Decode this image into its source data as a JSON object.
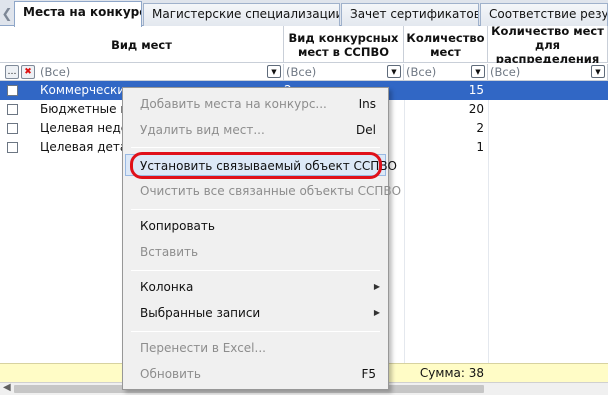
{
  "tabs": [
    {
      "label": "Места на конкурс",
      "active": true
    },
    {
      "label": "Магистерские специализации",
      "active": false
    },
    {
      "label": "Зачет сертификатов",
      "active": false
    },
    {
      "label": "Соответствие резуль",
      "active": false
    }
  ],
  "columns": {
    "vid_mest": "Вид мест",
    "konkurs_ssp": "Вид конкурсных мест в ССПВО",
    "kolichestvo": "Количество мест",
    "raspredelenie": "Количество мест для распределения"
  },
  "filter": {
    "value": "(Все)"
  },
  "rows": [
    {
      "name": "Коммерческие",
      "c3": "2",
      "count": "15",
      "selected": true
    },
    {
      "name": "Бюджетные ме",
      "c3": "",
      "count": "20",
      "selected": false
    },
    {
      "name": "Целевая недета",
      "c3": "",
      "count": "2",
      "selected": false
    },
    {
      "name": "Целевая детали",
      "c3": "",
      "count": "1",
      "selected": false
    }
  ],
  "footer": {
    "sum": "Сумма: 38"
  },
  "context_menu": {
    "items": [
      {
        "label": "Добавить места на конкурс...",
        "shortcut": "Ins",
        "disabled": true
      },
      {
        "label": "Удалить вид мест...",
        "shortcut": "Del",
        "disabled": true
      },
      {
        "label": "Установить связываемый объект ССПВО",
        "highlighted": true
      },
      {
        "label": "Очистить все связанные объекты ССПВО",
        "disabled": true
      },
      {
        "label": "Копировать",
        "disabled": false
      },
      {
        "label": "Вставить",
        "disabled": true
      },
      {
        "label": "Колонка",
        "submenu": true
      },
      {
        "label": "Выбранные записи",
        "submenu": true
      },
      {
        "label": "Перенести в Excel...",
        "disabled": true
      },
      {
        "label": "Обновить",
        "shortcut": "F5",
        "disabled": true
      }
    ]
  },
  "colors": {
    "selection": "#3167c5",
    "footer_bg": "#fffcc6",
    "annotation_red": "#e0101a",
    "menu_highlight": "#dce8f7"
  }
}
